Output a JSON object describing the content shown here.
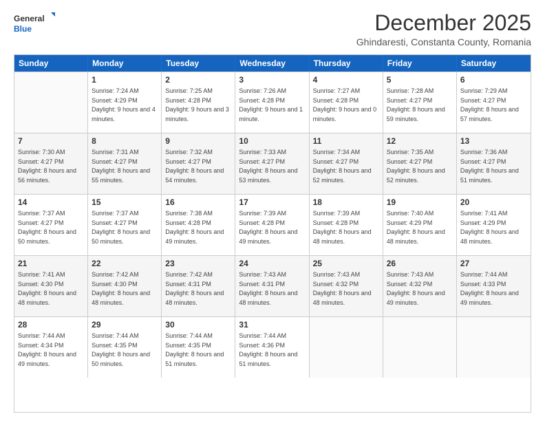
{
  "logo": {
    "general": "General",
    "blue": "Blue"
  },
  "header": {
    "month": "December 2025",
    "location": "Ghindaresti, Constanta County, Romania"
  },
  "weekdays": [
    "Sunday",
    "Monday",
    "Tuesday",
    "Wednesday",
    "Thursday",
    "Friday",
    "Saturday"
  ],
  "weeks": [
    [
      {
        "day": "",
        "empty": true
      },
      {
        "day": "1",
        "sunrise": "7:24 AM",
        "sunset": "4:29 PM",
        "daylight": "9 hours and 4 minutes."
      },
      {
        "day": "2",
        "sunrise": "7:25 AM",
        "sunset": "4:28 PM",
        "daylight": "9 hours and 3 minutes."
      },
      {
        "day": "3",
        "sunrise": "7:26 AM",
        "sunset": "4:28 PM",
        "daylight": "9 hours and 1 minute."
      },
      {
        "day": "4",
        "sunrise": "7:27 AM",
        "sunset": "4:28 PM",
        "daylight": "9 hours and 0 minutes."
      },
      {
        "day": "5",
        "sunrise": "7:28 AM",
        "sunset": "4:27 PM",
        "daylight": "8 hours and 59 minutes."
      },
      {
        "day": "6",
        "sunrise": "7:29 AM",
        "sunset": "4:27 PM",
        "daylight": "8 hours and 57 minutes."
      }
    ],
    [
      {
        "day": "7",
        "sunrise": "7:30 AM",
        "sunset": "4:27 PM",
        "daylight": "8 hours and 56 minutes."
      },
      {
        "day": "8",
        "sunrise": "7:31 AM",
        "sunset": "4:27 PM",
        "daylight": "8 hours and 55 minutes."
      },
      {
        "day": "9",
        "sunrise": "7:32 AM",
        "sunset": "4:27 PM",
        "daylight": "8 hours and 54 minutes."
      },
      {
        "day": "10",
        "sunrise": "7:33 AM",
        "sunset": "4:27 PM",
        "daylight": "8 hours and 53 minutes."
      },
      {
        "day": "11",
        "sunrise": "7:34 AM",
        "sunset": "4:27 PM",
        "daylight": "8 hours and 52 minutes."
      },
      {
        "day": "12",
        "sunrise": "7:35 AM",
        "sunset": "4:27 PM",
        "daylight": "8 hours and 52 minutes."
      },
      {
        "day": "13",
        "sunrise": "7:36 AM",
        "sunset": "4:27 PM",
        "daylight": "8 hours and 51 minutes."
      }
    ],
    [
      {
        "day": "14",
        "sunrise": "7:37 AM",
        "sunset": "4:27 PM",
        "daylight": "8 hours and 50 minutes."
      },
      {
        "day": "15",
        "sunrise": "7:37 AM",
        "sunset": "4:27 PM",
        "daylight": "8 hours and 50 minutes."
      },
      {
        "day": "16",
        "sunrise": "7:38 AM",
        "sunset": "4:28 PM",
        "daylight": "8 hours and 49 minutes."
      },
      {
        "day": "17",
        "sunrise": "7:39 AM",
        "sunset": "4:28 PM",
        "daylight": "8 hours and 49 minutes."
      },
      {
        "day": "18",
        "sunrise": "7:39 AM",
        "sunset": "4:28 PM",
        "daylight": "8 hours and 48 minutes."
      },
      {
        "day": "19",
        "sunrise": "7:40 AM",
        "sunset": "4:29 PM",
        "daylight": "8 hours and 48 minutes."
      },
      {
        "day": "20",
        "sunrise": "7:41 AM",
        "sunset": "4:29 PM",
        "daylight": "8 hours and 48 minutes."
      }
    ],
    [
      {
        "day": "21",
        "sunrise": "7:41 AM",
        "sunset": "4:30 PM",
        "daylight": "8 hours and 48 minutes."
      },
      {
        "day": "22",
        "sunrise": "7:42 AM",
        "sunset": "4:30 PM",
        "daylight": "8 hours and 48 minutes."
      },
      {
        "day": "23",
        "sunrise": "7:42 AM",
        "sunset": "4:31 PM",
        "daylight": "8 hours and 48 minutes."
      },
      {
        "day": "24",
        "sunrise": "7:43 AM",
        "sunset": "4:31 PM",
        "daylight": "8 hours and 48 minutes."
      },
      {
        "day": "25",
        "sunrise": "7:43 AM",
        "sunset": "4:32 PM",
        "daylight": "8 hours and 48 minutes."
      },
      {
        "day": "26",
        "sunrise": "7:43 AM",
        "sunset": "4:32 PM",
        "daylight": "8 hours and 49 minutes."
      },
      {
        "day": "27",
        "sunrise": "7:44 AM",
        "sunset": "4:33 PM",
        "daylight": "8 hours and 49 minutes."
      }
    ],
    [
      {
        "day": "28",
        "sunrise": "7:44 AM",
        "sunset": "4:34 PM",
        "daylight": "8 hours and 49 minutes."
      },
      {
        "day": "29",
        "sunrise": "7:44 AM",
        "sunset": "4:35 PM",
        "daylight": "8 hours and 50 minutes."
      },
      {
        "day": "30",
        "sunrise": "7:44 AM",
        "sunset": "4:35 PM",
        "daylight": "8 hours and 51 minutes."
      },
      {
        "day": "31",
        "sunrise": "7:44 AM",
        "sunset": "4:36 PM",
        "daylight": "8 hours and 51 minutes."
      },
      {
        "day": "",
        "empty": true
      },
      {
        "day": "",
        "empty": true
      },
      {
        "day": "",
        "empty": true
      }
    ]
  ]
}
